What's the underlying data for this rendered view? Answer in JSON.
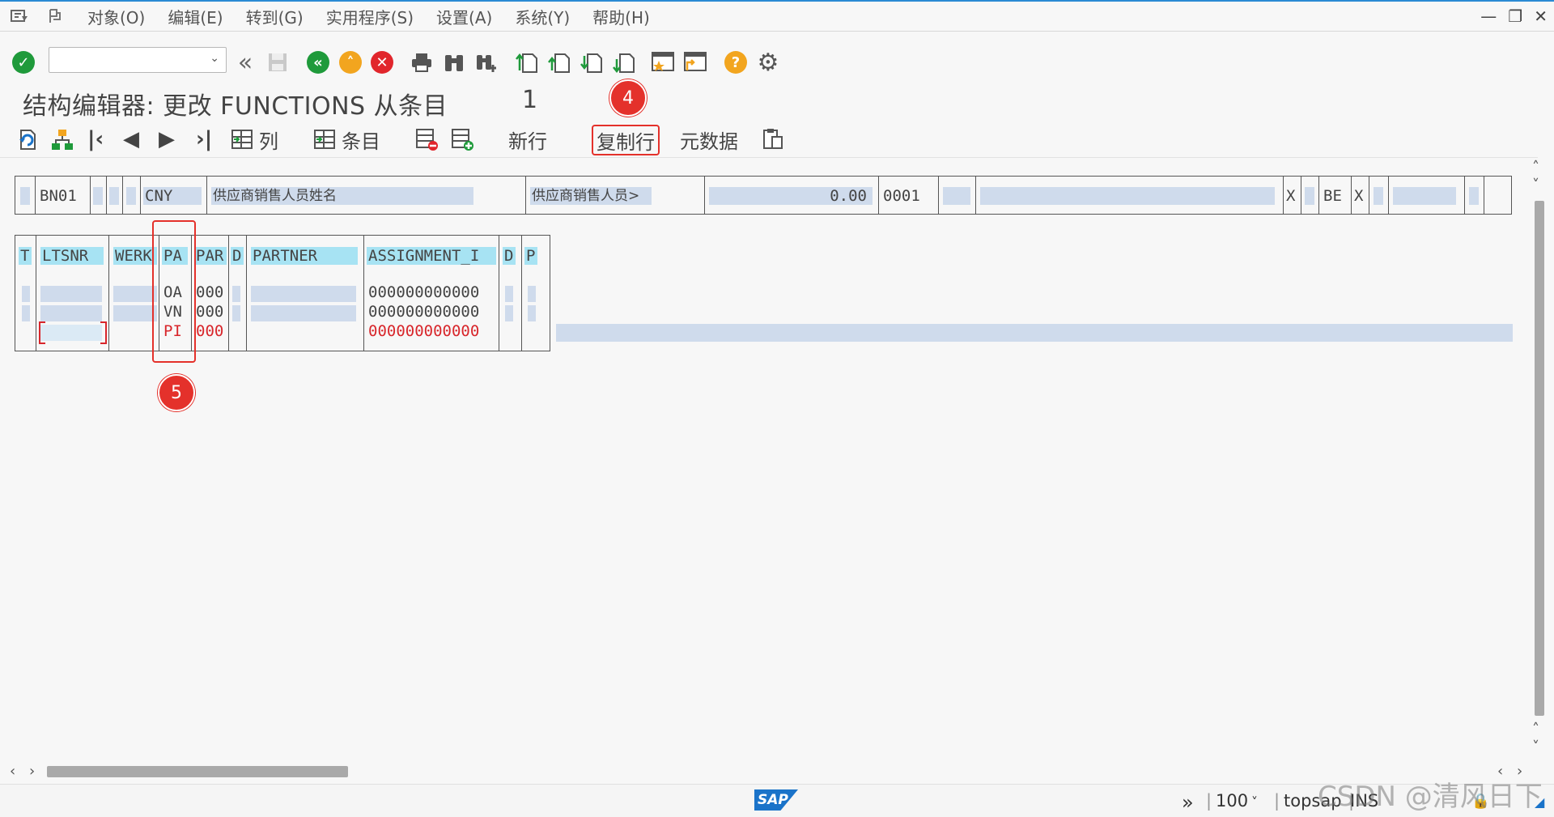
{
  "menu": {
    "items": [
      "对象(O)",
      "编辑(E)",
      "转到(G)",
      "实用程序(S)",
      "设置(A)",
      "系统(Y)",
      "帮助(H)"
    ]
  },
  "toolbar": {
    "command_field_value": ""
  },
  "title": {
    "text": "结构编辑器: 更改 FUNCTIONS 从条目",
    "count": "1"
  },
  "annotations": {
    "badge_4": "4",
    "badge_5": "5"
  },
  "app_toolbar": {
    "column_label": "列",
    "entry_label": "条目",
    "new_row_label": "新行",
    "copy_row_label": "复制行",
    "metadata_label": "元数据"
  },
  "header_row": {
    "company": "BN01",
    "currency": "CNY",
    "vendor_name_label": "供应商销售人员姓名",
    "vendor_contact": "供应商销售人员>",
    "amount": "0.00",
    "code": "0001",
    "flag1": "X",
    "country": "BE",
    "flag2": "X"
  },
  "grid": {
    "columns": [
      "T",
      "LTSNR",
      "WERK",
      "PA",
      "PAR",
      "D",
      "PARTNER",
      "ASSIGNMENT_I",
      "D",
      "P"
    ],
    "rows": [
      {
        "pa": "OA",
        "par": "000",
        "assignment": "000000000000"
      },
      {
        "pa": "VN",
        "par": "000",
        "assignment": "000000000000"
      },
      {
        "pa": "PI",
        "par": "000",
        "assignment": "000000000000"
      }
    ]
  },
  "status": {
    "zoom": "100",
    "system": "topsap",
    "mode": "INS"
  },
  "watermark": "CSDN @清风日下",
  "colors": {
    "accent": "#2a8ad4",
    "highlight_red": "#e4312b",
    "field_bg": "#cfdbec",
    "header_cyan": "#a7e3f3"
  }
}
